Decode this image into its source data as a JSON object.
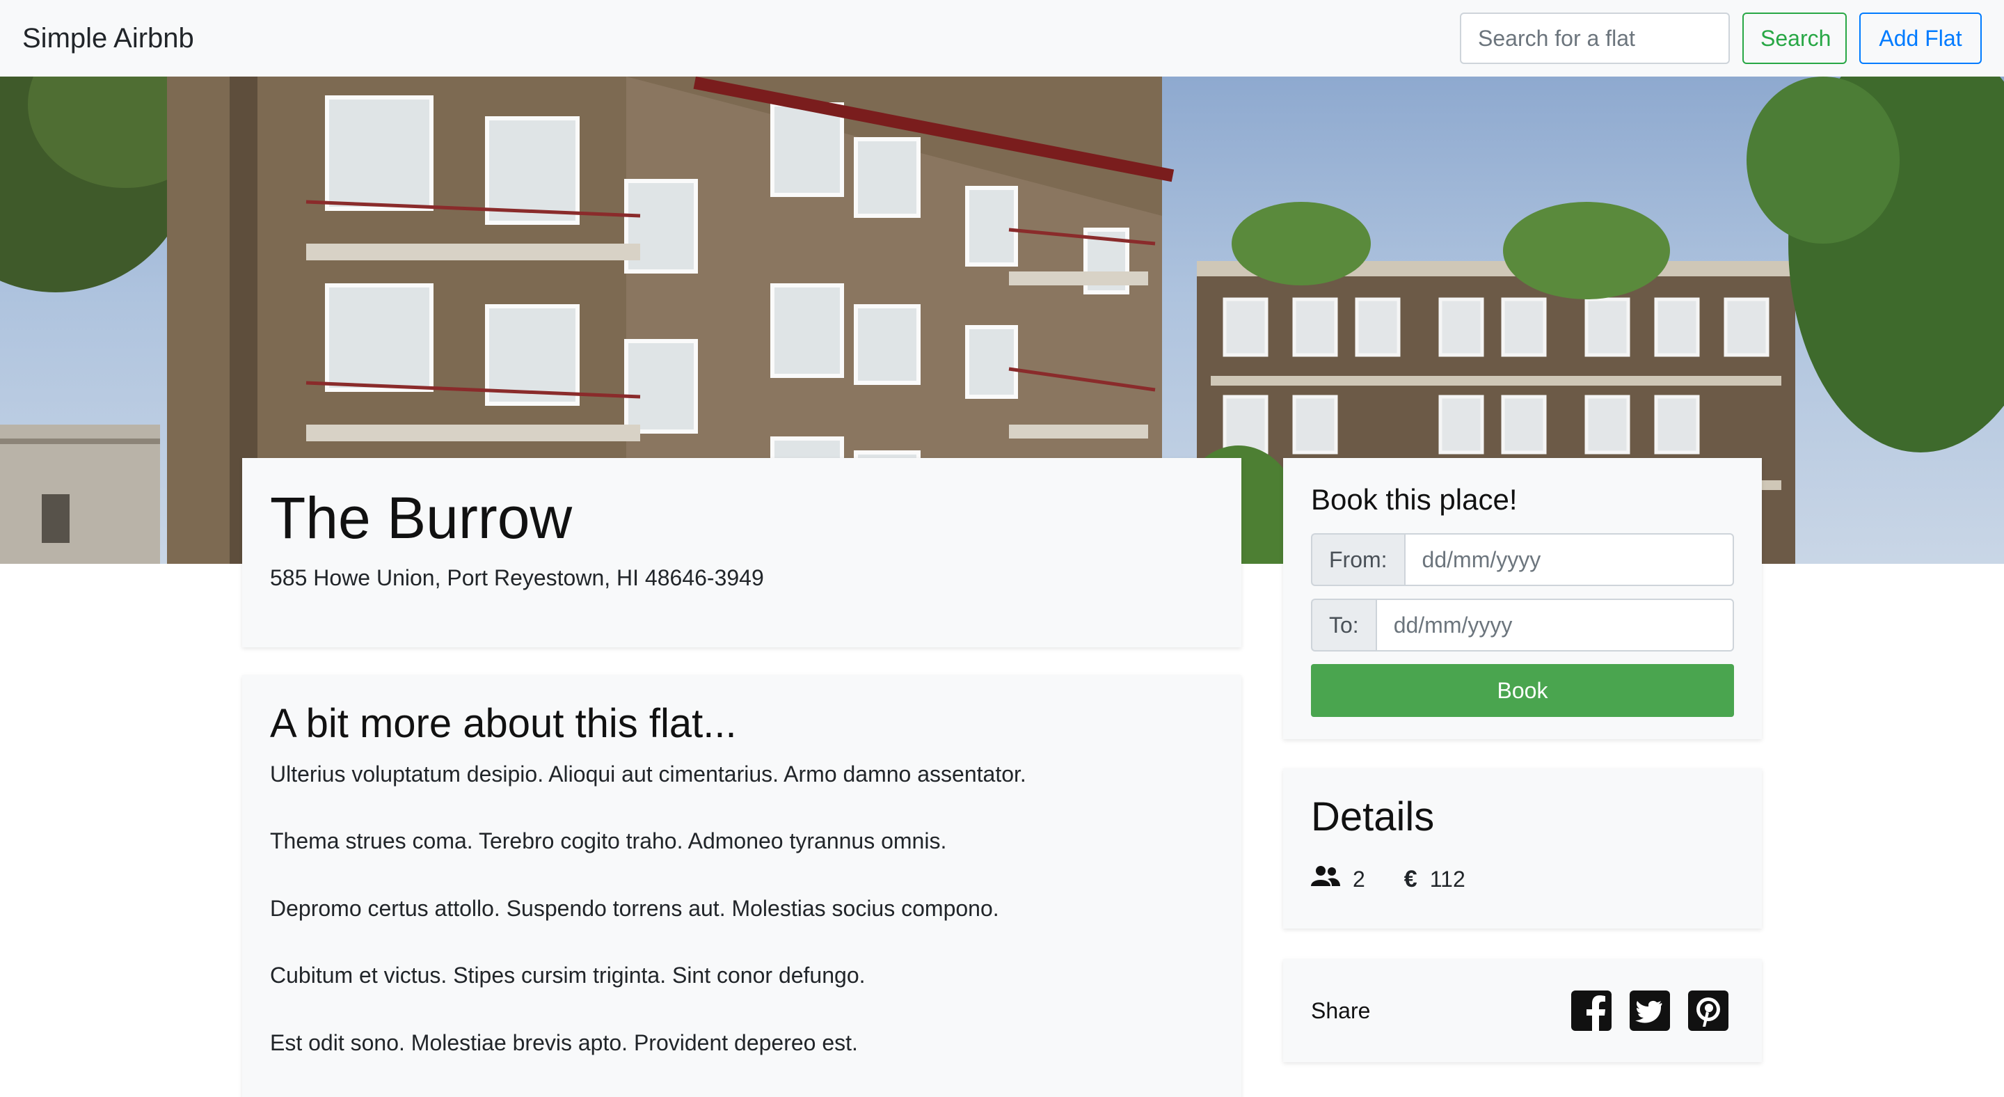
{
  "navbar": {
    "brand": "Simple Airbnb",
    "search_placeholder": "Search for a flat",
    "search_button": "Search",
    "add_button": "Add Flat"
  },
  "flat": {
    "name": "The Burrow",
    "address": "585 Howe Union, Port Reyestown, HI 48646-3949"
  },
  "about": {
    "title": "A bit more about this flat...",
    "paragraphs": [
      "Ulterius voluptatum desipio. Alioqui aut cimentarius. Armo damno assentator.",
      "Thema strues coma. Terebro cogito traho. Admoneo tyrannus omnis.",
      "Depromo certus attollo. Suspendo torrens aut. Molestias socius compono.",
      "Cubitum et victus. Stipes cursim triginta. Sint conor defungo.",
      "Est odit sono. Molestiae brevis apto. Provident depereo est."
    ]
  },
  "booking": {
    "title": "Book this place!",
    "from_label": "From:",
    "to_label": "To:",
    "date_placeholder": "dd/mm/yyyy",
    "book_button": "Book"
  },
  "details": {
    "title": "Details",
    "guests": "2",
    "price": "112",
    "icons": [
      "users-icon",
      "euro-icon"
    ]
  },
  "share": {
    "label": "Share",
    "icons": [
      "facebook-icon",
      "twitter-icon",
      "pinterest-icon"
    ]
  },
  "colors": {
    "success": "#28a745",
    "primary": "#007bff",
    "book_button": "#4aa54f",
    "card_background": "#f8f9fa"
  }
}
